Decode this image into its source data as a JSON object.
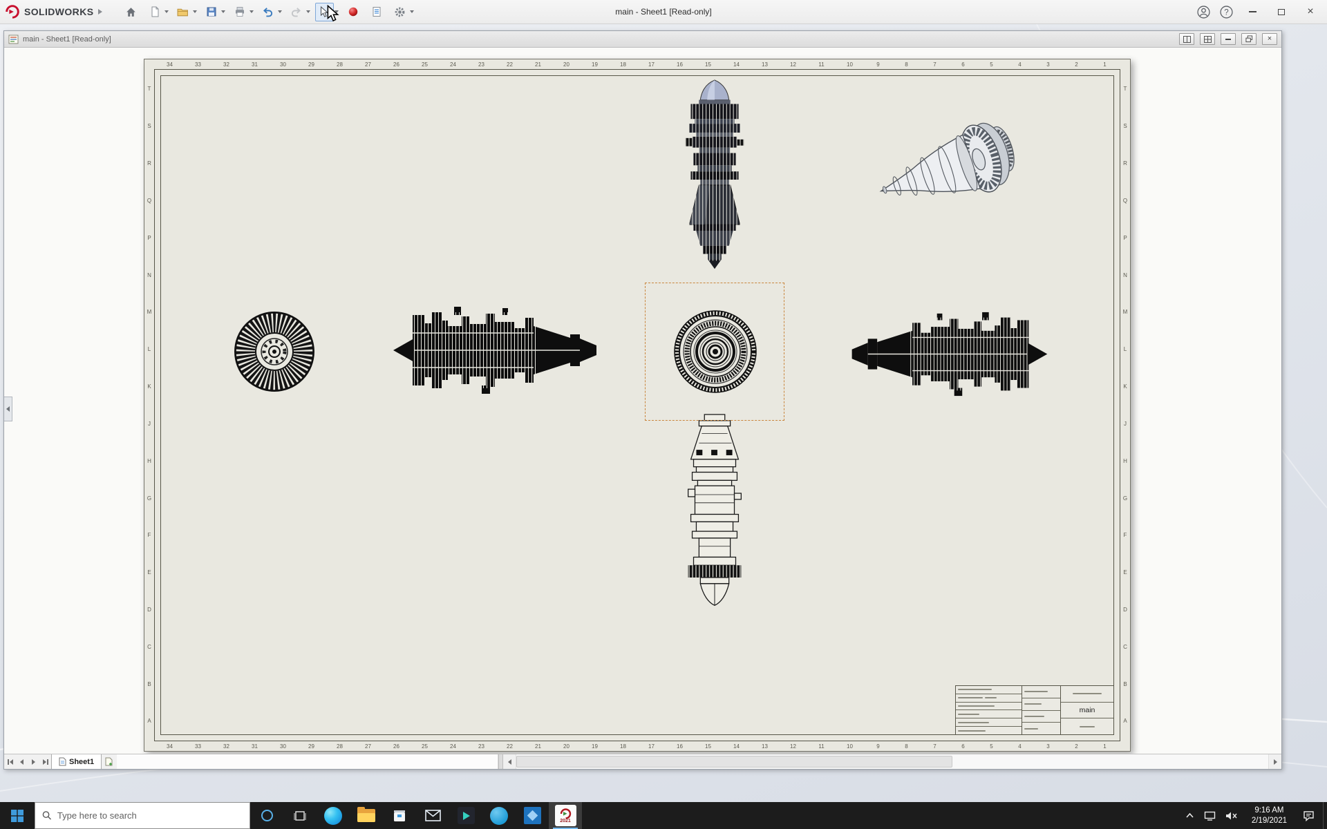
{
  "colors": {
    "brand-red": "#c8102e",
    "selection-orange": "#c9853c",
    "accent-blue": "#3f9bdc",
    "sheet-paper": "#e9e8e0"
  },
  "titlebar": {
    "brand": "SOLIDWORKS",
    "window_title": "main - Sheet1 [Read-only]"
  },
  "doc_window": {
    "title": "main - Sheet1 [Read-only]"
  },
  "glyphs": {
    "help": "?",
    "close": "×"
  },
  "sheet": {
    "tab_label": "Sheet1",
    "zones": {
      "columns": [
        "34",
        "33",
        "32",
        "31",
        "30",
        "29",
        "28",
        "27",
        "26",
        "25",
        "24",
        "23",
        "22",
        "21",
        "20",
        "19",
        "18",
        "17",
        "16",
        "15",
        "14",
        "13",
        "12",
        "11",
        "10",
        "9",
        "8",
        "7",
        "6",
        "5",
        "4",
        "3",
        "2",
        "1"
      ],
      "rows": [
        "T",
        "S",
        "R",
        "Q",
        "P",
        "N",
        "M",
        "L",
        "K",
        "J",
        "H",
        "G",
        "F",
        "E",
        "D",
        "C",
        "B",
        "A"
      ]
    },
    "title_block": {
      "drawing_name": "main"
    }
  },
  "taskbar": {
    "search_placeholder": "Type here to search",
    "solidworks_badge": "2021",
    "clock": {
      "time": "9:16 AM",
      "date": "2/19/2021"
    }
  }
}
